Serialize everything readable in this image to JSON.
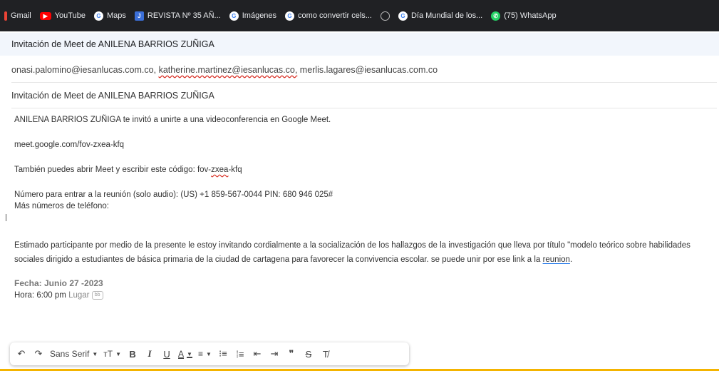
{
  "bookmarks": [
    {
      "label": "Gmail",
      "icon": "gmail-icon"
    },
    {
      "label": "YouTube",
      "icon": "youtube-icon"
    },
    {
      "label": "Maps",
      "icon": "google-icon"
    },
    {
      "label": "REVISTA Nº 35 AÑ...",
      "icon": "revista-icon"
    },
    {
      "label": "Imágenes",
      "icon": "google-icon"
    },
    {
      "label": "como convertir cels...",
      "icon": "google-icon"
    },
    {
      "label": "",
      "icon": "globe-icon"
    },
    {
      "label": "Día Mundial de los...",
      "icon": "google-icon"
    },
    {
      "label": "(75) WhatsApp",
      "icon": "whatsapp-icon"
    }
  ],
  "window": {
    "title": "Invitación de Meet de ANILENA BARRIOS ZUÑIGA"
  },
  "compose": {
    "recipients": {
      "r1": "onasi.palomino@iesanlucas.com.co,",
      "r2": "katherine.martinez@iesanlucas.co,",
      "r3": "merlis.lagares@iesanlucas.com.co"
    },
    "subject": "Invitación de Meet de ANILENA BARRIOS ZUÑIGA",
    "body": {
      "invite_line": "ANILENA BARRIOS ZUÑIGA te invitó a unirte a una videoconferencia en Google Meet.",
      "meet_link": "meet.google.com/fov-zxea-kfq",
      "code_prefix": "También puedes abrir Meet y escribir este código: fov-",
      "code_squiggle": "zxea",
      "code_suffix": "-kfq",
      "phone_line": "Número para entrar a la reunión (solo audio): (US) +1 859-567-0044 PIN: 680 946 025#",
      "more_numbers": "Más números de teléfono:",
      "paragraph_main": "Estimado participante por medio de la presente le estoy invitando cordialmente a la socialización de los hallazgos de la investigación que lleva por título \"modelo teórico sobre habilidades sociales dirigido a estudiantes de básica primaria de la ciudad de cartagena para favorecer la convivencia escolar. se puede unir por ese link a la ",
      "paragraph_link": "reunion",
      "paragraph_end": ".",
      "fecha": "Fecha: Junio 27 -2023",
      "hora": "Hora: 6:00 pm",
      "lugar": "Lugar",
      "chip": "bb"
    }
  },
  "toolbar": {
    "undo": "↶",
    "redo": "↷",
    "font": "Sans Serif",
    "size": "тT",
    "bold": "B",
    "italic": "I",
    "underline": "U",
    "text_color": "A",
    "align": "≡",
    "numbered_list": "⁝≡",
    "bulleted_list": "⁞≡",
    "indent_less": "⇤",
    "indent_more": "⇥",
    "quote": "❞",
    "strikethrough": "S",
    "clear_format": "T̸"
  },
  "colors": {
    "bookmark_bar": "#202124",
    "subject_bar": "#f2f6fc",
    "accent_bottom": "#f4b400",
    "spell_error": "#d93025"
  }
}
